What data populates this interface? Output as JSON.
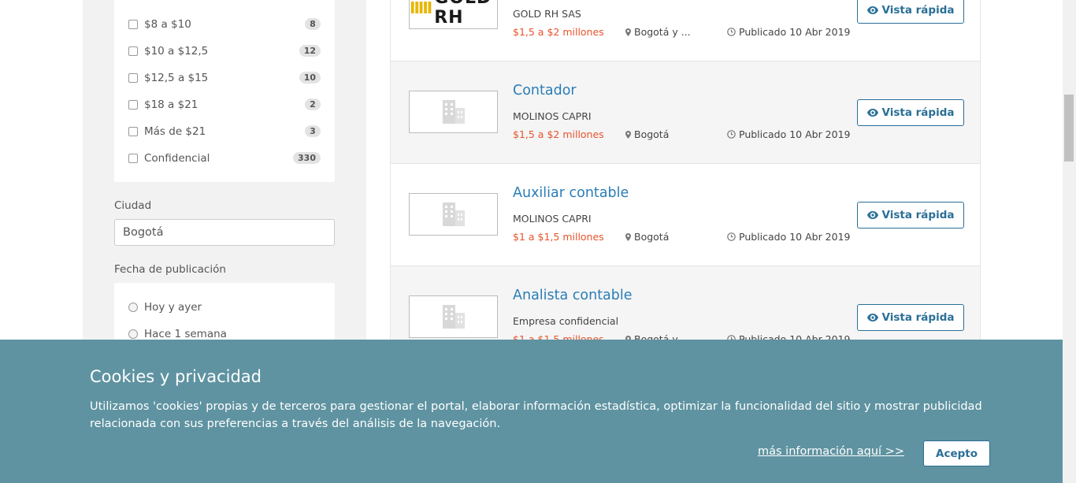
{
  "sidebar": {
    "salary_filters": [
      {
        "label": "$8 a $10",
        "count": "8"
      },
      {
        "label": "$10 a $12,5",
        "count": "12"
      },
      {
        "label": "$12,5 a $15",
        "count": "10"
      },
      {
        "label": "$18 a $21",
        "count": "2"
      },
      {
        "label": "Más de $21",
        "count": "3"
      },
      {
        "label": "Confidencial",
        "count": "330"
      }
    ],
    "city_label": "Ciudad",
    "city_value": "Bogotá",
    "date_label": "Fecha de publicación",
    "date_options": [
      "Hoy y ayer",
      "Hace 1 semana"
    ]
  },
  "jobs": [
    {
      "title": "",
      "company": "GOLD RH SAS",
      "salary": "$1,5 a $2 millones",
      "location": "Bogotá y ...",
      "published": "Publicado 10 Abr 2019",
      "button": "Vista rápida",
      "logo": "GOLD RH"
    },
    {
      "title": "Contador",
      "company": "MOLINOS CAPRI",
      "salary": "$1,5 a $2 millones",
      "location": "Bogotá",
      "published": "Publicado 10 Abr 2019",
      "button": "Vista rápida"
    },
    {
      "title": "Auxiliar contable",
      "company": "MOLINOS CAPRI",
      "salary": "$1 a $1,5 millones",
      "location": "Bogotá",
      "published": "Publicado 10 Abr 2019",
      "button": "Vista rápida"
    },
    {
      "title": "Analista contable",
      "company": "Empresa confidencial",
      "salary": "$1 a $1,5 millones",
      "location": "Bogotá y ...",
      "published": "Publicado 10 Abr 2019",
      "button": "Vista rápida"
    }
  ],
  "cookies": {
    "title": "Cookies y privacidad",
    "text": "Utilizamos 'cookies' propias y de terceros para gestionar el portal, elaborar información estadística, optimizar la funcionalidad del sitio y mostrar publicidad relacionada con sus preferencias a través del análisis de la navegación.",
    "link": "más información aquí >>",
    "accept": "Acepto"
  },
  "colors": {
    "accent": "#2a7db6",
    "salary": "#e8532b",
    "cookie_bg": "#5f93a1"
  }
}
